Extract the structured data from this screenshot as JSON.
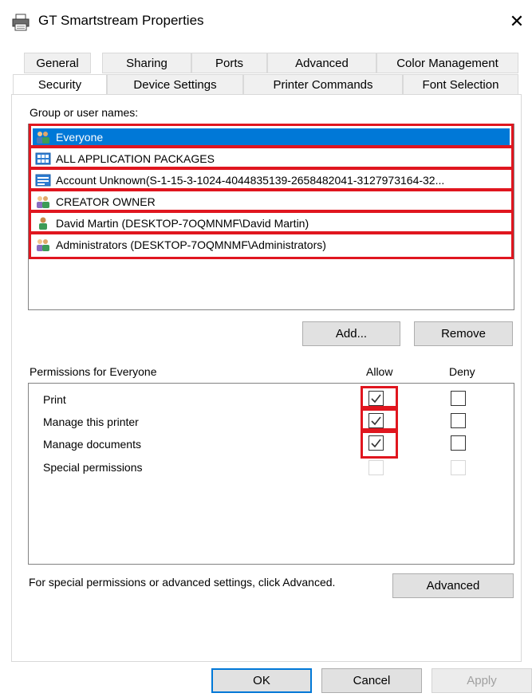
{
  "window": {
    "title": "GT Smartstream Properties",
    "close_glyph": "✕",
    "icon": "printer-icon"
  },
  "tabs_row1": [
    "General",
    "Sharing",
    "Ports",
    "Advanced",
    "Color Management"
  ],
  "tabs_row2": [
    "Security",
    "Device Settings",
    "Printer Commands",
    "Font Selection"
  ],
  "active_tab": "Security",
  "security": {
    "group_label": "Group or user names:",
    "users": [
      {
        "name": "Everyone",
        "icon": "group-icon",
        "selected": true
      },
      {
        "name": "ALL APPLICATION PACKAGES",
        "icon": "app-packages-icon",
        "selected": false
      },
      {
        "name": "Account Unknown(S-1-15-3-1024-4044835139-2658482041-3127973164-32...",
        "icon": "unknown-account-icon",
        "selected": false
      },
      {
        "name": "CREATOR OWNER",
        "icon": "group-icon",
        "selected": false
      },
      {
        "name": "David Martin (DESKTOP-7OQMNMF\\David Martin)",
        "icon": "user-icon",
        "selected": false
      },
      {
        "name": "Administrators (DESKTOP-7OQMNMF\\Administrators)",
        "icon": "group-icon",
        "selected": false
      }
    ],
    "add_label": "Add...",
    "remove_label": "Remove",
    "permissions_label": "Permissions for Everyone",
    "allow_header": "Allow",
    "deny_header": "Deny",
    "permissions": [
      {
        "name": "Print",
        "allow": true,
        "deny": false,
        "enabled": true
      },
      {
        "name": "Manage this printer",
        "allow": true,
        "deny": false,
        "enabled": true
      },
      {
        "name": "Manage documents",
        "allow": true,
        "deny": false,
        "enabled": true
      },
      {
        "name": "Special permissions",
        "allow": false,
        "deny": false,
        "enabled": false
      }
    ],
    "advanced_text": "For special permissions or advanced settings, click Advanced.",
    "advanced_label": "Advanced"
  },
  "footer": {
    "ok_label": "OK",
    "cancel_label": "Cancel",
    "apply_label": "Apply"
  },
  "colors": {
    "selection": "#0078d7",
    "highlight_border": "#e0161f"
  }
}
